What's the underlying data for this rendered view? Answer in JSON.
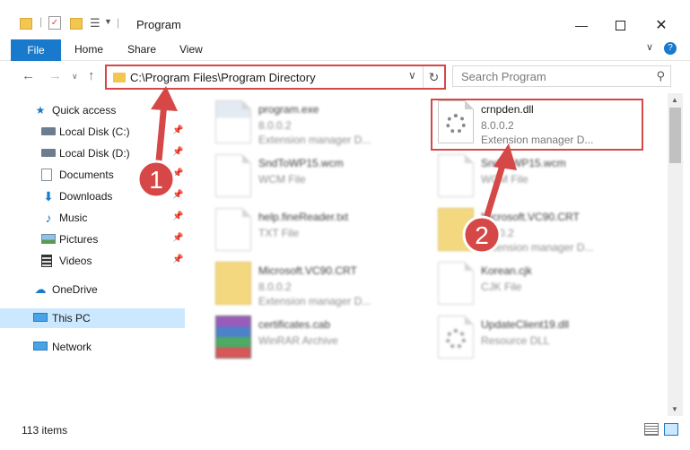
{
  "window": {
    "title": "Program",
    "minimize_icon": "minimize-icon",
    "maximize_icon": "maximize-icon",
    "close_icon": "close-icon"
  },
  "ribbon": {
    "tabs": [
      {
        "label": "File"
      },
      {
        "label": "Home"
      },
      {
        "label": "Share"
      },
      {
        "label": "View"
      }
    ],
    "accent": "#1979ca"
  },
  "navbar": {
    "address": "C:\\Program Files\\Program Directory",
    "search_placeholder": "Search Program"
  },
  "sidebar": {
    "items": [
      {
        "label": "Quick access",
        "icon": "star-icon",
        "pinned": false
      },
      {
        "label": "Local Disk (C:)",
        "icon": "drive-icon",
        "pinned": true
      },
      {
        "label": "Local Disk (D:)",
        "icon": "drive-icon",
        "pinned": true
      },
      {
        "label": "Documents",
        "icon": "documents-icon",
        "pinned": true
      },
      {
        "label": "Downloads",
        "icon": "download-icon",
        "pinned": true
      },
      {
        "label": "Music",
        "icon": "music-icon",
        "pinned": true
      },
      {
        "label": "Pictures",
        "icon": "pictures-icon",
        "pinned": true
      },
      {
        "label": "Videos",
        "icon": "videos-icon",
        "pinned": true
      },
      {
        "label": "OneDrive",
        "icon": "cloud-icon",
        "pinned": false
      },
      {
        "label": "This PC",
        "icon": "computer-icon",
        "pinned": false,
        "selected": true
      },
      {
        "label": "Network",
        "icon": "network-icon",
        "pinned": false
      }
    ]
  },
  "files": [
    {
      "name": "program.exe",
      "line1": "8.0.0.2",
      "line2": "Extension manager D...",
      "icon": "exe-icon"
    },
    {
      "name": "crnpden.dll",
      "line1": "8.0.0.2",
      "line2": "Extension manager D...",
      "icon": "dll-gear-icon",
      "highlighted": true
    },
    {
      "name": "SndToWP15.wcm",
      "line1": "WCM File",
      "line2": "",
      "icon": "file-icon"
    },
    {
      "name": "SndToWP15.wcm",
      "line1": "WCM File",
      "line2": "",
      "icon": "file-icon"
    },
    {
      "name": "help.fineReader.txt",
      "line1": "TXT File",
      "line2": "",
      "icon": "file-icon"
    },
    {
      "name": "Microsoft.VC90.CRT",
      "line1": "8.0.0.2",
      "line2": "Extension manager D...",
      "icon": "folder-file-icon"
    },
    {
      "name": "Microsoft.VC90.CRT",
      "line1": "8.0.0.2",
      "line2": "Extension manager D...",
      "icon": "folder-file-icon"
    },
    {
      "name": "Korean.cjk",
      "line1": "CJK File",
      "line2": "",
      "icon": "file-icon"
    },
    {
      "name": "certificates.cab",
      "line1": "WinRAR Archive",
      "line2": "",
      "icon": "rar-icon"
    },
    {
      "name": "UpdateClient19.dll",
      "line1": "Resource DLL",
      "line2": "",
      "icon": "dll-gear-icon"
    }
  ],
  "status": {
    "item_count": "113 items"
  },
  "annotations": [
    {
      "number": "1",
      "color": "#d64848"
    },
    {
      "number": "2",
      "color": "#d64848"
    }
  ]
}
